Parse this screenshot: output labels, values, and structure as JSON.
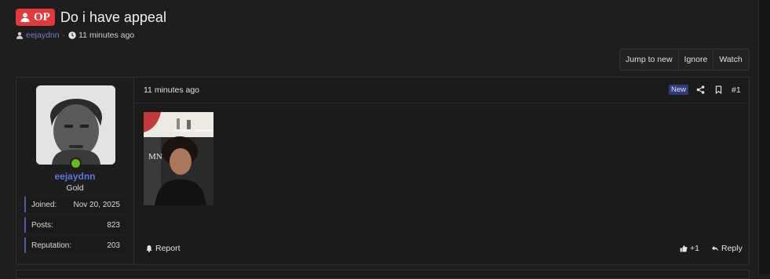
{
  "thread": {
    "op_badge": "OP",
    "title": "Do i have appeal",
    "author": "eejaydnn",
    "separator": "·",
    "time": "11 minutes ago"
  },
  "actions": {
    "jump": "Jump to new",
    "ignore": "Ignore",
    "watch": "Watch"
  },
  "post": {
    "user": {
      "name": "eejaydnn",
      "rank": "Gold",
      "online": true,
      "stats": [
        {
          "label": "Joined:",
          "value": "Nov 20, 2025"
        },
        {
          "label": "Posts:",
          "value": "823"
        },
        {
          "label": "Reputation:",
          "value": "203"
        }
      ]
    },
    "time": "11 minutes ago",
    "new_badge": "New",
    "number": "#1",
    "footer": {
      "report": "Report",
      "like": "+1",
      "reply": "Reply"
    }
  },
  "icons": [
    "user-icon",
    "clock-icon",
    "share-icon",
    "bookmark-icon",
    "bell-icon",
    "thumbs-up-icon",
    "reply-icon"
  ],
  "colors": {
    "background": "#1e1e1e",
    "op_badge": "#e5383b",
    "username": "#5f77d9",
    "online": "#6bb51d",
    "new_badge": "#2f3d7a"
  }
}
